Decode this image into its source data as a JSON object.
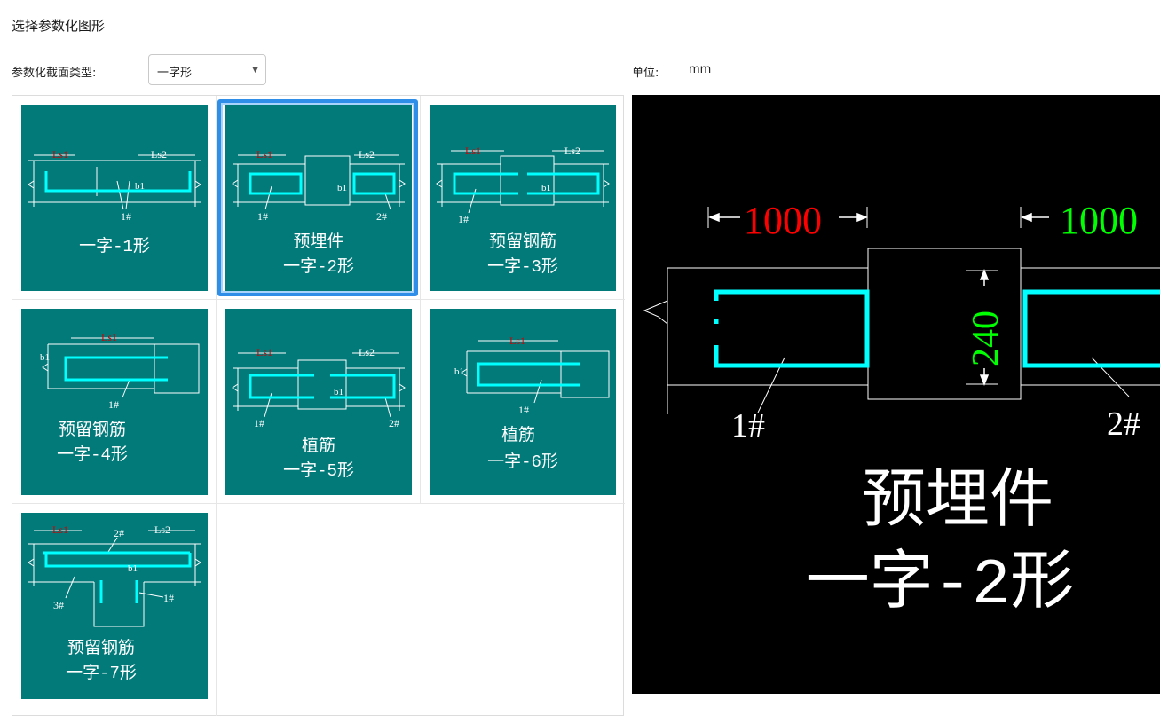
{
  "title": "选择参数化图形",
  "section_type": {
    "label": "参数化截面类型:",
    "selected": "一字形"
  },
  "unit": {
    "label": "单位:",
    "value": "mm"
  },
  "colors": {
    "tile": "#037a7a",
    "selection": "#2f8fe8",
    "preview_bg": "#000000",
    "rebar": "#00ffff",
    "dim_red": "#ff0000",
    "dim_green": "#00ff00"
  },
  "thumbs": [
    {
      "line1": "",
      "line2": "一字-1形",
      "ls1": "Ls1",
      "ls2": "Ls2",
      "b": "b1",
      "n1": "1#"
    },
    {
      "line1": "预埋件",
      "line2": "一字-2形",
      "ls1": "Ls1",
      "ls2": "Ls2",
      "b": "b1",
      "n1": "1#",
      "n2": "2#"
    },
    {
      "line1": "预留钢筋",
      "line2": "一字-3形",
      "ls1": "Ls1",
      "ls2": "Ls2",
      "b": "b1",
      "n1": "1#"
    },
    {
      "line1": "预留钢筋",
      "line2": "一字-4形",
      "ls1": "Ls1",
      "b": "b1",
      "n1": "1#"
    },
    {
      "line1": "植筋",
      "line2": "一字-5形",
      "ls1": "Ls1",
      "ls2": "Ls2",
      "b": "b1",
      "n1": "1#",
      "n2": "2#"
    },
    {
      "line1": "植筋",
      "line2": "一字-6形",
      "ls1": "Ls1",
      "b": "b1",
      "n1": "1#"
    },
    {
      "line1": "预留钢筋",
      "line2": "一字-7形",
      "ls1": "Ls1",
      "ls2": "Ls2",
      "b": "b1",
      "n1": "1#",
      "n2": "2#",
      "n3": "3#"
    }
  ],
  "preview": {
    "dim_left": "1000",
    "dim_right": "1000",
    "dim_width": "240",
    "n1": "1#",
    "n2": "2#",
    "line1": "预埋件",
    "line2": "一字-2形"
  }
}
